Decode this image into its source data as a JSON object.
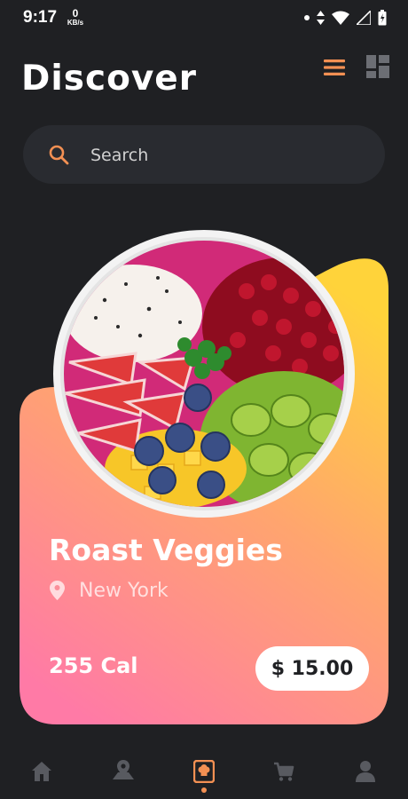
{
  "status_bar": {
    "time": "9:17",
    "net_speed_value": "0",
    "net_speed_unit": "KB/s"
  },
  "header": {
    "title": "Discover",
    "view_list_icon": "list-view-icon",
    "view_grid_icon": "grid-view-icon"
  },
  "search": {
    "placeholder": "Search",
    "value": ""
  },
  "card": {
    "name": "Roast Veggies",
    "location": "New York",
    "calories": "255 Cal",
    "price": "$ 15.00",
    "image": "acai-fruit-bowl-image"
  },
  "bottom_nav": {
    "items": [
      {
        "icon": "home-icon",
        "active": false
      },
      {
        "icon": "map-location-icon",
        "active": false
      },
      {
        "icon": "recipe-book-icon",
        "active": true
      },
      {
        "icon": "cart-icon",
        "active": false
      },
      {
        "icon": "profile-icon",
        "active": false
      }
    ]
  },
  "colors": {
    "background": "#1f2023",
    "accent": "#f39053",
    "search_bg": "#292b30",
    "card_gradient_top": "#ffd33a",
    "card_gradient_mid": "#ffa56e",
    "card_gradient_bottom": "#ff7aa6",
    "nav_inactive": "#585a60"
  }
}
